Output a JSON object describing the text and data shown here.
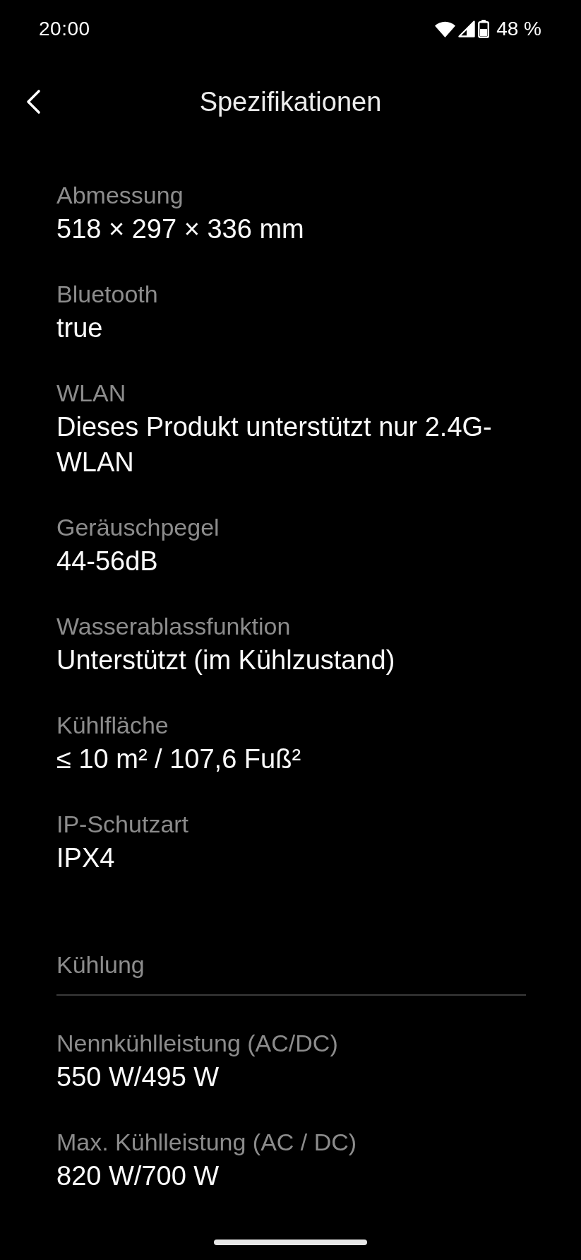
{
  "status_bar": {
    "time": "20:00",
    "battery": "48 %"
  },
  "header": {
    "title": "Spezifikationen"
  },
  "sections": [
    {
      "items": [
        {
          "label": "Abmessung",
          "value": "518 × 297 × 336 mm"
        },
        {
          "label": "Bluetooth",
          "value": "true"
        },
        {
          "label": "WLAN",
          "value": "Dieses Produkt unterstützt nur 2.4G-WLAN"
        },
        {
          "label": "Geräuschpegel",
          "value": "44-56dB"
        },
        {
          "label": "Wasserablassfunktion",
          "value": "Unterstützt (im Kühlzustand)"
        },
        {
          "label": "Kühlfläche",
          "value": "≤ 10 m² / 107,6 Fuß²"
        },
        {
          "label": "IP-Schutzart",
          "value": "IPX4"
        }
      ]
    },
    {
      "title": "Kühlung",
      "items": [
        {
          "label": "Nennkühlleistung (AC/DC)",
          "value": "550 W/495 W"
        },
        {
          "label": "Max. Kühlleistung (AC / DC)",
          "value": "820 W/700 W"
        }
      ]
    }
  ]
}
